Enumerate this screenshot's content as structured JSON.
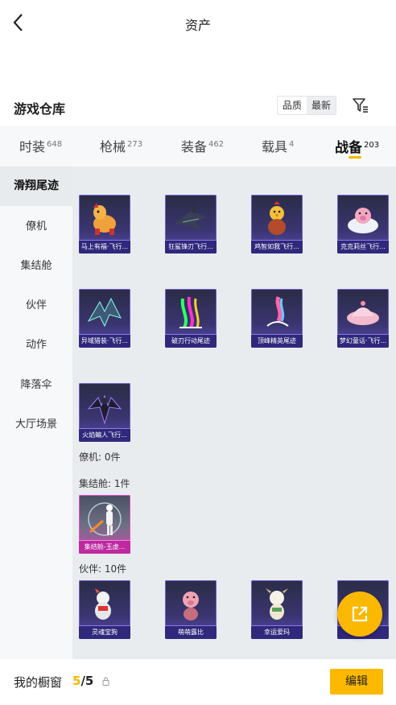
{
  "header": {
    "title": "资产"
  },
  "section": {
    "title": "游戏仓库",
    "sort_options": [
      "品质",
      "最新"
    ]
  },
  "tabs": [
    {
      "label": "时装",
      "count": "648"
    },
    {
      "label": "枪械",
      "count": "273"
    },
    {
      "label": "装备",
      "count": "462"
    },
    {
      "label": "载具",
      "count": "4"
    },
    {
      "label": "战备",
      "count": "203"
    }
  ],
  "sidebar": {
    "items": [
      {
        "label": "滑翔尾迹"
      },
      {
        "label": "僚机"
      },
      {
        "label": "集结舱"
      },
      {
        "label": "伙伴"
      },
      {
        "label": "动作"
      },
      {
        "label": "降落伞"
      },
      {
        "label": "大厅场景"
      }
    ]
  },
  "groups": {
    "glide_items": [
      {
        "name": "马上有福·飞行...",
        "icon": "horse-plush-icon"
      },
      {
        "name": "狂鲨锋刃飞行...",
        "icon": "shark-glider-icon"
      },
      {
        "name": "鸡智如我飞行...",
        "icon": "chicken-mascot-icon"
      },
      {
        "name": "克克莉丝飞行...",
        "icon": "pink-cloud-pig-icon"
      },
      {
        "name": "异域猎装·飞行...",
        "icon": "dragon-wing-icon"
      },
      {
        "name": "破刃行动尾迹",
        "icon": "rainbow-trail-icon"
      },
      {
        "name": "顶峰精英尾迹",
        "icon": "flame-trail-icon"
      },
      {
        "name": "梦幻童话·飞行...",
        "icon": "pink-carriage-icon"
      },
      {
        "name": "火焰蝙人飞行...",
        "icon": "bat-warrior-icon"
      }
    ],
    "wingman_label": "僚机: 0件",
    "pod_label": "集结舱: 1件",
    "pod_items": [
      {
        "name": "集结舱-玉虚...",
        "icon": "jade-figure-icon"
      }
    ],
    "partner_label": "伙伴: 10件",
    "partner_items": [
      {
        "name": "灵魂宝狗",
        "icon": "white-dog-icon"
      },
      {
        "name": "萌萌露比",
        "icon": "pink-pig-icon"
      },
      {
        "name": "幸运爱玛",
        "icon": "white-goat-icon"
      },
      {
        "name": "...",
        "icon": "partner-icon"
      }
    ]
  },
  "bottom": {
    "label": "我的橱窗",
    "current": "5",
    "total": "/5",
    "edit_label": "编辑"
  },
  "colors": {
    "accent": "#fbb800",
    "card_purple": "#5a4ab0",
    "card_pink": "#c94bb0"
  }
}
